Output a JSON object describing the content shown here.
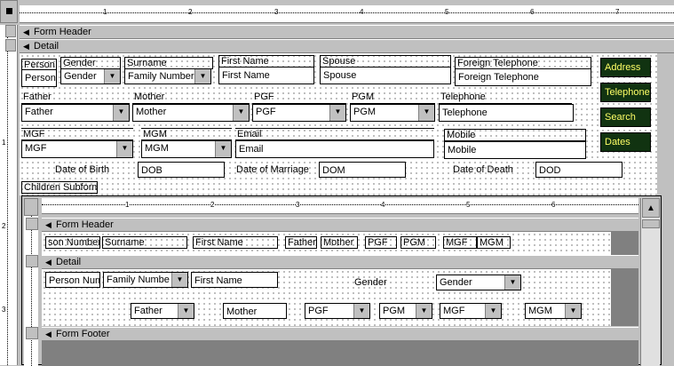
{
  "main_ruler": {
    "ticks": [
      "1",
      "2",
      "3",
      "4",
      "5",
      "6",
      "7"
    ]
  },
  "sections": {
    "form_header": "Form Header",
    "detail": "Detail"
  },
  "detail": {
    "person_label": "Person",
    "person_value": "Person",
    "gender_label": "Gender",
    "gender_value": "Gender",
    "surname_label": "Surname",
    "surname_value": "Family Number",
    "first_name_label": "First Name",
    "first_name_value": "First Name",
    "spouse_label": "Spouse",
    "spouse_value": "Spouse",
    "foreign_tel_label": "Foreign Telephone",
    "foreign_tel_value": "Foreign Telephone",
    "father_label": "Father",
    "father_value": "Father",
    "mother_label": "Mother",
    "mother_value": "Mother",
    "pgf_label": "PGF",
    "pgf_value": "PGF",
    "pgm_label": "PGM",
    "pgm_value": "PGM",
    "telephone_label": "Telephone",
    "telephone_value": "Telephone",
    "mgf_label": "MGF",
    "mgf_value": "MGF",
    "mgm_label": "MGM",
    "mgm_value": "MGM",
    "email_label": "Email",
    "email_value": "Email",
    "mobile_label": "Mobile",
    "mobile_value": "Mobile",
    "dob_label": "Date of Birth",
    "dob_value": "DOB",
    "dom_label": "Date of Marriage",
    "dom_value": "DOM",
    "dod_label": "Date of Death",
    "dod_value": "DOD",
    "children_label": "Children Subform"
  },
  "buttons": {
    "address": "Address",
    "telephone": "Telephone",
    "search": "Search",
    "dates": "Dates"
  },
  "left_ruler": {
    "marks": [
      "1",
      "2",
      "3"
    ]
  },
  "subform": {
    "ruler_ticks": [
      "1",
      "2",
      "3",
      "4",
      "5",
      "6"
    ],
    "form_header": "Form Header",
    "detail": "Detail",
    "form_footer": "Form Footer",
    "header_labels": [
      "son Number",
      "Surname",
      "First Name",
      "Father",
      "Mother",
      "PGF",
      "PGM",
      "MGF",
      "MGM"
    ],
    "person_num": "Person Num",
    "family_num": "Family Numbe",
    "first_name": "First Name",
    "gender_label": "Gender",
    "gender_value": "Gender",
    "father": "Father",
    "mother": "Mother",
    "pgf": "PGF",
    "pgm": "PGM",
    "mgf": "MGF",
    "mgm": "MGM"
  }
}
